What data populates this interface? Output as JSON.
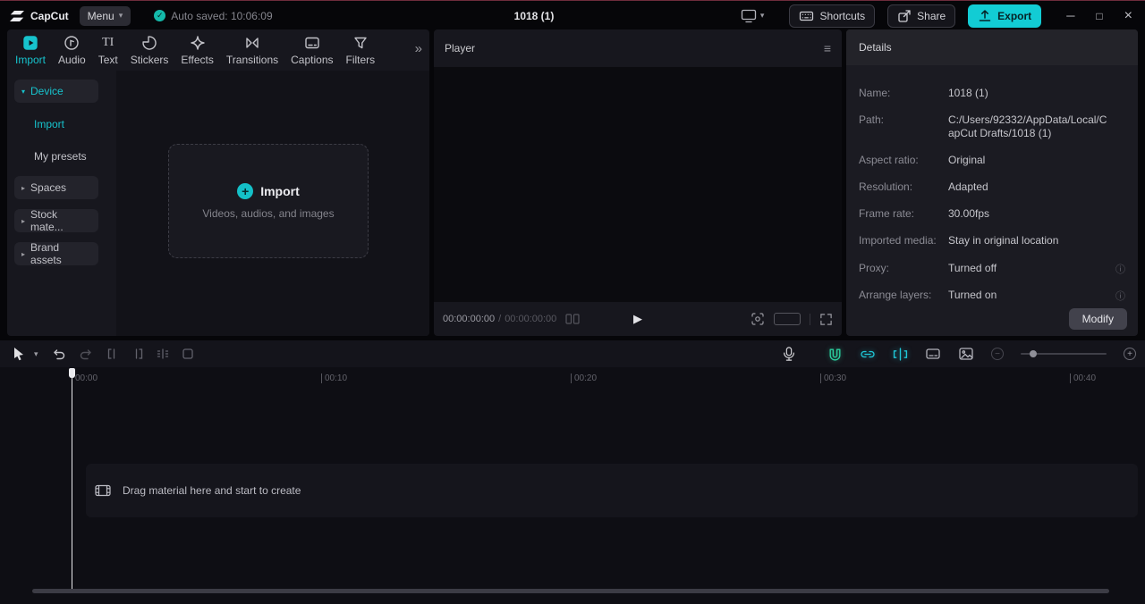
{
  "colors": {
    "accent": "#17c3cd",
    "export_bg": "#12ccd4",
    "autosave_check": "#14b9aa",
    "toggle_green": "#2bcf9e",
    "toggle_cyan": "#1fc8d8"
  },
  "titlebar": {
    "app_name": "CapCut",
    "menu_label": "Menu",
    "autosave_text": "Auto saved: 10:06:09",
    "project_title": "1018 (1)",
    "shortcuts_label": "Shortcuts",
    "share_label": "Share",
    "export_label": "Export"
  },
  "media_tabs": [
    {
      "label": "Import"
    },
    {
      "label": "Audio"
    },
    {
      "label": "Text"
    },
    {
      "label": "Stickers"
    },
    {
      "label": "Effects"
    },
    {
      "label": "Transitions"
    },
    {
      "label": "Captions"
    },
    {
      "label": "Filters"
    }
  ],
  "sidebar": {
    "device": "Device",
    "device_children": [
      "Import",
      "My presets"
    ],
    "groups": [
      "Spaces",
      "Stock mate...",
      "Brand assets"
    ]
  },
  "import_area": {
    "button_label": "Import",
    "hint": "Videos, audios, and images"
  },
  "player": {
    "title": "Player",
    "time_current": "00:00:00:00",
    "time_separator": "/",
    "time_total": "00:00:00:00"
  },
  "details": {
    "title": "Details",
    "fields": [
      {
        "label": "Name:",
        "value": "1018 (1)"
      },
      {
        "label": "Path:",
        "value": "C:/Users/92332/AppData/Local/CapCut Drafts/1018 (1)"
      },
      {
        "label": "Aspect ratio:",
        "value": "Original"
      },
      {
        "label": "Resolution:",
        "value": "Adapted"
      },
      {
        "label": "Frame rate:",
        "value": "30.00fps"
      },
      {
        "label": "Imported media:",
        "value": "Stay in original location"
      },
      {
        "label": "Proxy:",
        "value": "Turned off"
      },
      {
        "label": "Arrange layers:",
        "value": "Turned on"
      }
    ],
    "modify_label": "Modify"
  },
  "timeline": {
    "ruler": [
      "00:00",
      "00:10",
      "00:20",
      "00:30",
      "00:40"
    ],
    "empty_hint": "Drag material here and start to create"
  },
  "glyphs": {
    "caret_down": "▾",
    "triangle_right": "▸",
    "triangle_down": "▾",
    "double_chevron": "»",
    "check": "✓",
    "minimize": "─",
    "maximize": "□",
    "close": "×",
    "play": "▶",
    "hamburger": "≡",
    "info": "ⓘ",
    "plus": "+",
    "minus": "−",
    "text_tab": "TI"
  }
}
